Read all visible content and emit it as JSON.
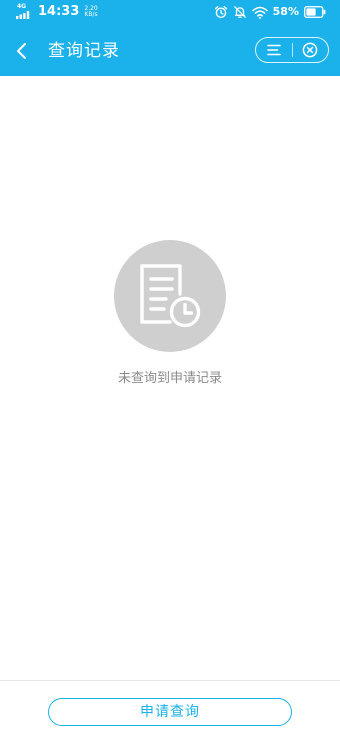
{
  "status_bar": {
    "network": "4G",
    "time": "14:33",
    "speed_value": "2.20",
    "speed_unit": "KB/s",
    "battery": "58%"
  },
  "header": {
    "title": "查询记录",
    "icons": [
      "back-chevron-icon",
      "menu-icon",
      "close-circle-icon"
    ]
  },
  "empty_state": {
    "icon": "document-clock-icon",
    "message": "未查询到申请记录"
  },
  "footer": {
    "button_label": "申请查询"
  },
  "colors": {
    "primary": "#1bb2ec",
    "empty_icon_bg": "#cfcfcf",
    "empty_text": "#8a8a8a"
  }
}
